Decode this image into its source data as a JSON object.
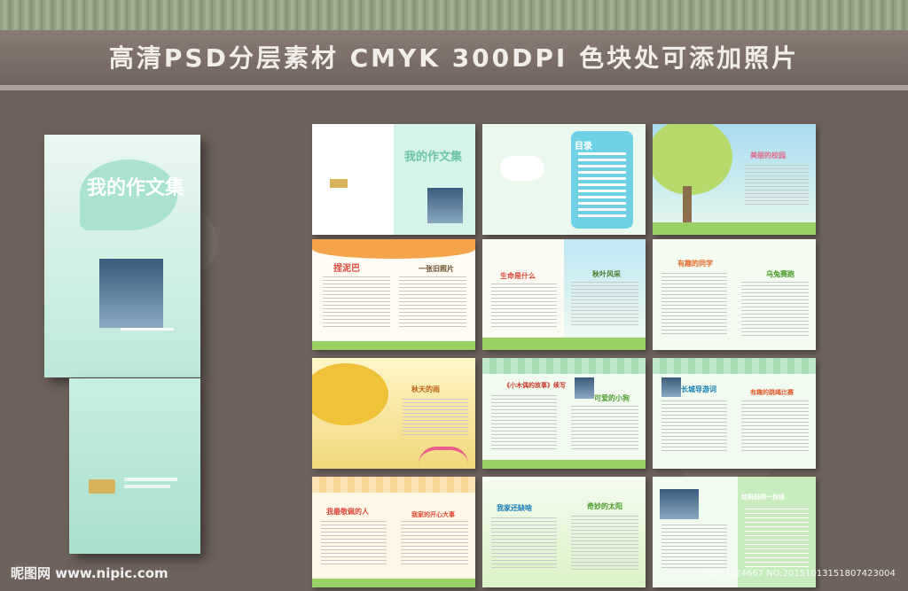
{
  "header": {
    "title": "高清PSD分层素材   CMYK   300DPI   色块处可添加照片"
  },
  "cover": {
    "title": "我的作文集"
  },
  "spreads": [
    {
      "label": "我的作文集"
    },
    {
      "label": "目录"
    },
    {
      "label": "美丽的校园"
    },
    {
      "label": "捏泥巴"
    },
    {
      "label": "一张旧照片"
    },
    {
      "label": "生命是什么"
    },
    {
      "label": "秋叶风采"
    },
    {
      "label": "有趣的同学"
    },
    {
      "label": "乌兔赛跑"
    },
    {
      "label": "秋天的雨"
    },
    {
      "label": "《小木偶的故事》续写"
    },
    {
      "label": "可爱的小狗"
    },
    {
      "label": "长城导游词"
    },
    {
      "label": "有趣的跳绳比赛"
    },
    {
      "label": "我最敬佩的人"
    },
    {
      "label": "我家的开心大事"
    },
    {
      "label": "我家还缺啥"
    },
    {
      "label": "奇妙的太阳"
    },
    {
      "label": "给妈妈的一封信"
    }
  ],
  "footer": {
    "site": "昵图网 www.nipic.com",
    "id": "ID:13124667 NO:20151013151807423004"
  },
  "colors": {
    "background": "#6f625c",
    "cover": "#bde8da",
    "accent_green": "#9ad167"
  }
}
